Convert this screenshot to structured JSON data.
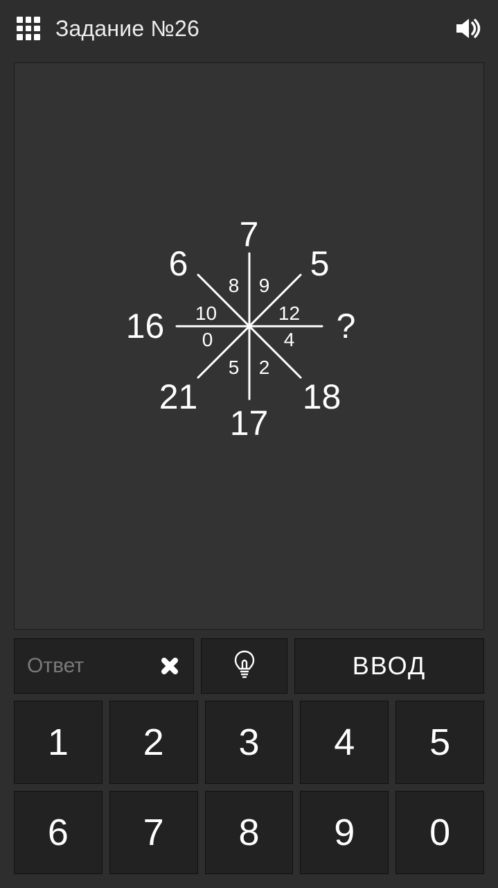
{
  "header": {
    "title": "Задание №26"
  },
  "puzzle": {
    "outer": {
      "n": "7",
      "ne": "5",
      "e": "?",
      "se": "18",
      "s": "17",
      "sw": "21",
      "w": "16",
      "nw": "6"
    },
    "inner": {
      "n_l": "8",
      "n_r": "9",
      "e_u": "12",
      "e_d": "4",
      "s_r": "2",
      "s_l": "5",
      "w_d": "0",
      "w_u": "10"
    }
  },
  "input": {
    "placeholder": "Ответ",
    "enter_label": "ВВОД"
  },
  "keypad": {
    "keys": [
      "1",
      "2",
      "3",
      "4",
      "5",
      "6",
      "7",
      "8",
      "9",
      "0"
    ]
  }
}
